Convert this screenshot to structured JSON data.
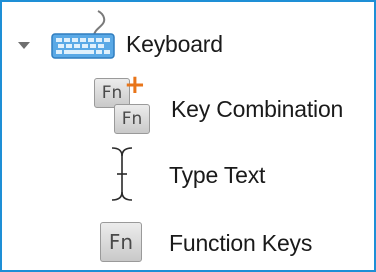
{
  "tree": {
    "parent": {
      "label": "Keyboard",
      "expanded": true,
      "icon": "keyboard-icon"
    },
    "children": [
      {
        "label": "Key Combination",
        "icon": "key-combination-icon",
        "icon_key_text": "Fn",
        "icon_plus": "+"
      },
      {
        "label": "Type Text",
        "icon": "text-cursor-icon"
      },
      {
        "label": "Function Keys",
        "icon": "function-key-icon",
        "icon_key_text": "Fn"
      }
    ]
  },
  "colors": {
    "frame_border": "#1e8fd6",
    "keyboard_icon": "#3a8fd0",
    "plus_accent": "#e8751a",
    "text": "#1a1a1a"
  }
}
